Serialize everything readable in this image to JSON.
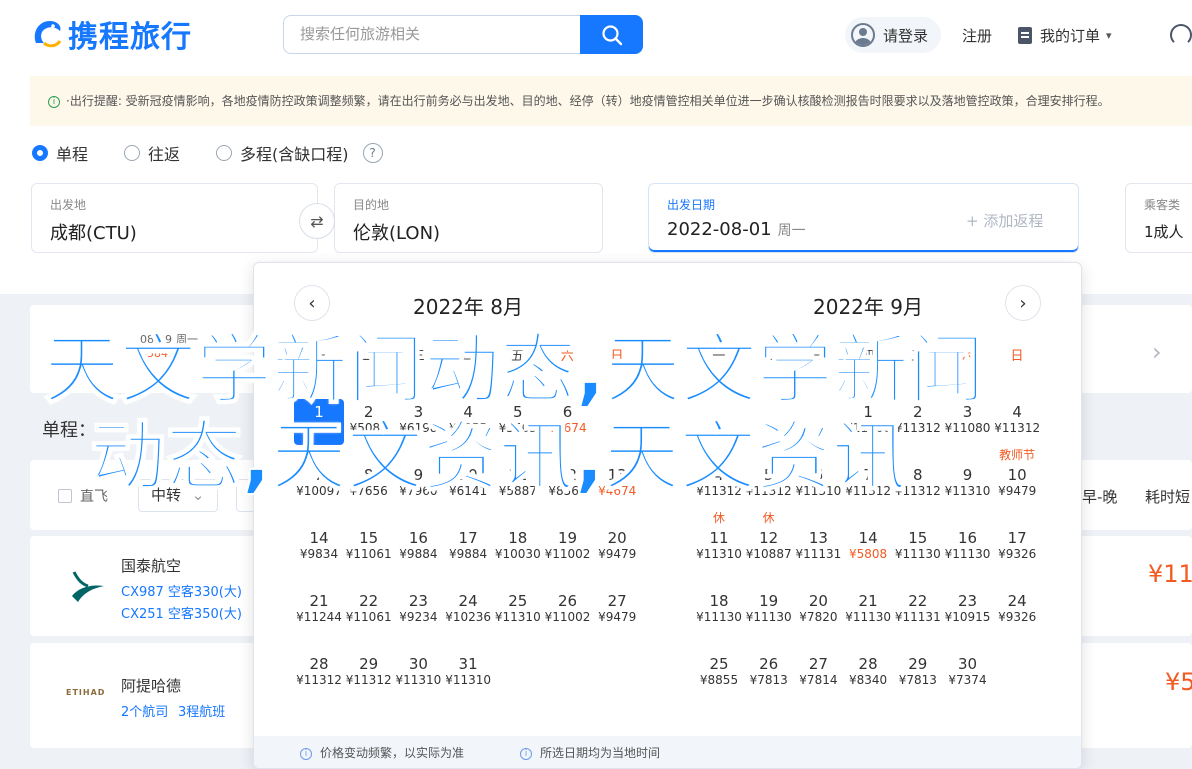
{
  "header": {
    "logo_text": "携程旅行",
    "search_placeholder": "搜索任何旅游相关",
    "login": "请登录",
    "register": "注册",
    "orders": "我的订单",
    "orders_caret": "▾",
    "brand_color": "#1677ff"
  },
  "notice": {
    "text": "·出行提醒: 受新冠疫情影响，各地疫情防控政策调整频繁，请在出行前务必与出发地、目的地、经停（转）地疫情管控相关单位进一步确认核酸检测报告时限要求以及落地管控政策，合理安排行程。"
  },
  "trip_types": [
    {
      "label": "单程",
      "selected": true
    },
    {
      "label": "往返",
      "selected": false
    },
    {
      "label": "多程(含缺口程)",
      "selected": false
    }
  ],
  "fields": {
    "from": {
      "label": "出发地",
      "value": "成都(CTU)"
    },
    "to": {
      "label": "目的地",
      "value": "伦敦(LON)"
    },
    "date": {
      "label": "出发日期",
      "value": "2022-08-01",
      "weekday": "周一"
    },
    "add_return": "+ 添加返程",
    "passengers": {
      "label": "乘客类",
      "value": "1成人"
    }
  },
  "date_strip": [
    {
      "date": "08-29",
      "weekday": "周一",
      "price": "¥5845"
    }
  ],
  "section_title": "单程：",
  "filters": {
    "direct_only": "直飞",
    "transfer": "中转",
    "sort_early_late": "早-晚",
    "sort_duration": "耗时短"
  },
  "flights": [
    {
      "airline": "国泰航空",
      "line1": "CX987 空客330(大)",
      "line2": "CX251 空客350(大)",
      "price": "¥11"
    },
    {
      "airline": "阿提哈德",
      "line1": "2个航司",
      "line2": "3程航班",
      "price": "¥5",
      "logo_text": "ETIHAD"
    }
  ],
  "calendar": {
    "left_title": "2022年 8月",
    "right_title": "2022年 9月",
    "weekdays": [
      "一",
      "二",
      "三",
      "四",
      "五",
      "六",
      "日"
    ],
    "august": [
      {
        "d": "1",
        "p": "¥294",
        "col": 0,
        "row": 0,
        "selected": true
      },
      {
        "d": "2",
        "p": "¥5086",
        "col": 1,
        "row": 0
      },
      {
        "d": "3",
        "p": "¥6198",
        "col": 2,
        "row": 0
      },
      {
        "d": "4",
        "p": "¥5055",
        "col": 3,
        "row": 0
      },
      {
        "d": "5",
        "p": "¥5563",
        "col": 4,
        "row": 0
      },
      {
        "d": "6",
        "p": "¥4674",
        "col": 5,
        "row": 0,
        "low": true
      },
      {
        "d": "7",
        "p": "¥10097",
        "col": 0,
        "row": 1
      },
      {
        "d": "8",
        "p": "¥7656",
        "col": 1,
        "row": 1
      },
      {
        "d": "9",
        "p": "¥7960",
        "col": 2,
        "row": 1
      },
      {
        "d": "10",
        "p": "¥6141",
        "col": 3,
        "row": 1
      },
      {
        "d": "11",
        "p": "¥5887",
        "col": 4,
        "row": 1
      },
      {
        "d": "12",
        "p": "¥8563",
        "col": 5,
        "row": 1
      },
      {
        "d": "13",
        "p": "¥4674",
        "col": 6,
        "row": 1,
        "low": true
      },
      {
        "d": "14",
        "p": "¥9834",
        "col": 0,
        "row": 2
      },
      {
        "d": "15",
        "p": "¥11061",
        "col": 1,
        "row": 2
      },
      {
        "d": "16",
        "p": "¥9884",
        "col": 2,
        "row": 2
      },
      {
        "d": "17",
        "p": "¥9884",
        "col": 3,
        "row": 2
      },
      {
        "d": "18",
        "p": "¥10030",
        "col": 4,
        "row": 2
      },
      {
        "d": "19",
        "p": "¥11002",
        "col": 5,
        "row": 2
      },
      {
        "d": "20",
        "p": "¥9479",
        "col": 6,
        "row": 2
      },
      {
        "d": "21",
        "p": "¥11244",
        "col": 0,
        "row": 3
      },
      {
        "d": "22",
        "p": "¥11061",
        "col": 1,
        "row": 3
      },
      {
        "d": "23",
        "p": "¥9234",
        "col": 2,
        "row": 3
      },
      {
        "d": "24",
        "p": "¥10236",
        "col": 3,
        "row": 3
      },
      {
        "d": "25",
        "p": "¥11310",
        "col": 4,
        "row": 3
      },
      {
        "d": "26",
        "p": "¥11002",
        "col": 5,
        "row": 3
      },
      {
        "d": "27",
        "p": "¥9479",
        "col": 6,
        "row": 3
      },
      {
        "d": "28",
        "p": "¥11312",
        "col": 0,
        "row": 4
      },
      {
        "d": "29",
        "p": "¥11312",
        "col": 1,
        "row": 4
      },
      {
        "d": "30",
        "p": "¥11310",
        "col": 2,
        "row": 4
      },
      {
        "d": "31",
        "p": "¥11310",
        "col": 3,
        "row": 4
      }
    ],
    "september": [
      {
        "d": "1",
        "p": "¥11300",
        "col": 3,
        "row": 0
      },
      {
        "d": "2",
        "p": "¥11312",
        "col": 4,
        "row": 0
      },
      {
        "d": "3",
        "p": "¥11080",
        "col": 5,
        "row": 0
      },
      {
        "d": "4",
        "p": "¥11312",
        "col": 6,
        "row": 0
      },
      {
        "d": "4",
        "p": "¥11312",
        "col": 0,
        "row": 1
      },
      {
        "d": "5",
        "p": "¥11312",
        "col": 1,
        "row": 1
      },
      {
        "d": "6",
        "p": "¥11310",
        "col": 2,
        "row": 1
      },
      {
        "d": "7",
        "p": "¥11312",
        "col": 3,
        "row": 1
      },
      {
        "d": "8",
        "p": "¥11312",
        "col": 4,
        "row": 1
      },
      {
        "d": "9",
        "p": "¥11310",
        "col": 5,
        "row": 1
      },
      {
        "d": "10",
        "p": "¥9479",
        "col": 6,
        "row": 1,
        "tag": "教师节"
      },
      {
        "d": "11",
        "p": "¥11310",
        "col": 0,
        "row": 2,
        "tag": "休"
      },
      {
        "d": "12",
        "p": "¥10887",
        "col": 1,
        "row": 2,
        "tag": "休"
      },
      {
        "d": "13",
        "p": "¥11131",
        "col": 2,
        "row": 2
      },
      {
        "d": "14",
        "p": "¥5808",
        "col": 3,
        "row": 2,
        "low": true
      },
      {
        "d": "15",
        "p": "¥11130",
        "col": 4,
        "row": 2
      },
      {
        "d": "16",
        "p": "¥11130",
        "col": 5,
        "row": 2
      },
      {
        "d": "17",
        "p": "¥9326",
        "col": 6,
        "row": 2
      },
      {
        "d": "18",
        "p": "¥11130",
        "col": 0,
        "row": 3
      },
      {
        "d": "19",
        "p": "¥11130",
        "col": 1,
        "row": 3
      },
      {
        "d": "20",
        "p": "¥7820",
        "col": 2,
        "row": 3
      },
      {
        "d": "21",
        "p": "¥11130",
        "col": 3,
        "row": 3
      },
      {
        "d": "22",
        "p": "¥11131",
        "col": 4,
        "row": 3
      },
      {
        "d": "23",
        "p": "¥10915",
        "col": 5,
        "row": 3
      },
      {
        "d": "24",
        "p": "¥9326",
        "col": 6,
        "row": 3
      },
      {
        "d": "25",
        "p": "¥8855",
        "col": 0,
        "row": 4
      },
      {
        "d": "26",
        "p": "¥7813",
        "col": 1,
        "row": 4
      },
      {
        "d": "27",
        "p": "¥7814",
        "col": 2,
        "row": 4
      },
      {
        "d": "28",
        "p": "¥8340",
        "col": 3,
        "row": 4
      },
      {
        "d": "29",
        "p": "¥7813",
        "col": 4,
        "row": 4
      },
      {
        "d": "30",
        "p": "¥7374",
        "col": 5,
        "row": 4
      }
    ],
    "footer_note1": "价格变动频繁，以实际为准",
    "footer_note2": "所选日期均为当地时间"
  },
  "watermark": {
    "line1": "天文学新闻动态,天文学新闻",
    "line2": "动态,天文资讯,天文资讯"
  }
}
